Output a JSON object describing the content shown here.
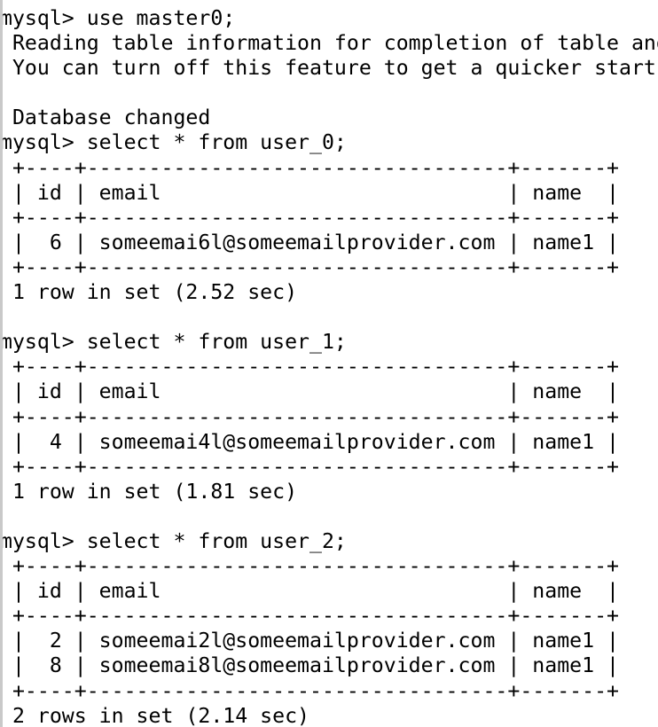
{
  "terminal": {
    "app": "mysql client",
    "background_color": "#ffffff",
    "foreground_color": "#000000",
    "prompt": "mysql> ",
    "edge_sliver_color": "#c9c9c9",
    "lines": [
      "mysql> use master0;",
      " Reading table information for completion of table and",
      " You can turn off this feature to get a quicker startu",
      "",
      " Database changed",
      "mysql> select * from user_0;",
      " +----+----------------------------------+-------+",
      " | id | email                            | name  |",
      " +----+----------------------------------+-------+",
      " |  6 | someemai6l@someemailprovider.com | name1 |",
      " +----+----------------------------------+-------+",
      " 1 row in set (2.52 sec)",
      "",
      "mysql> select * from user_1;",
      " +----+----------------------------------+-------+",
      " | id | email                            | name  |",
      " +----+----------------------------------+-------+",
      " |  4 | someemai4l@someemailprovider.com | name1 |",
      " +----+----------------------------------+-------+",
      " 1 row in set (1.81 sec)",
      "",
      "mysql> select * from user_2;",
      " +----+----------------------------------+-------+",
      " | id | email                            | name  |",
      " +----+----------------------------------+-------+",
      " |  2 | someemai2l@someemailprovider.com | name1 |",
      " |  8 | someemai8l@someemailprovider.com | name1 |",
      " +----+----------------------------------+-------+",
      " 2 rows in set (2.14 sec)"
    ],
    "commands": [
      {
        "command": "use master0;",
        "result": "Database changed"
      },
      {
        "command": "select * from user_0;",
        "result": "1 row in set (2.52 sec)"
      },
      {
        "command": "select * from user_1;",
        "result": "1 row in set (1.81 sec)"
      },
      {
        "command": "select * from user_2;",
        "result": "2 rows in set (2.14 sec)"
      }
    ],
    "notices": [
      "Reading table information for completion of table and",
      "You can turn off this feature to get a quicker startu"
    ],
    "result_sets": [
      {
        "table": "user_0",
        "columns": [
          "id",
          "email",
          "name"
        ],
        "rows": [
          [
            "6",
            "someemai6l@someemailprovider.com",
            "name1"
          ]
        ],
        "summary": "1 row in set (2.52 sec)",
        "row_count": 1,
        "elapsed_seconds": "2.52"
      },
      {
        "table": "user_1",
        "columns": [
          "id",
          "email",
          "name"
        ],
        "rows": [
          [
            "4",
            "someemai4l@someemailprovider.com",
            "name1"
          ]
        ],
        "summary": "1 row in set (1.81 sec)",
        "row_count": 1,
        "elapsed_seconds": "1.81"
      },
      {
        "table": "user_2",
        "columns": [
          "id",
          "email",
          "name"
        ],
        "rows": [
          [
            "2",
            "someemai2l@someemailprovider.com",
            "name1"
          ],
          [
            "8",
            "someemai8l@someemailprovider.com",
            "name1"
          ]
        ],
        "summary": "2 rows in set (2.14 sec)",
        "row_count": 2,
        "elapsed_seconds": "2.14"
      }
    ],
    "database": "master0"
  }
}
